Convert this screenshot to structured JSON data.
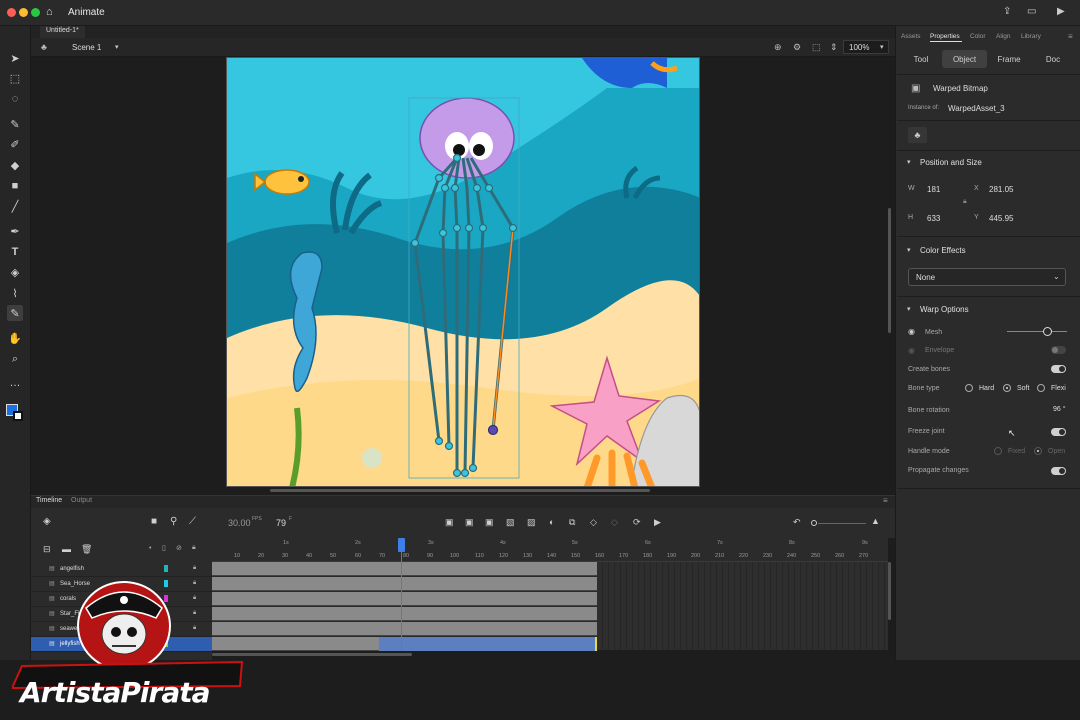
{
  "app": {
    "name": "Animate",
    "doc_tab": "Untitled-1*",
    "scene": "Scene 1",
    "zoom": "100%"
  },
  "panel": {
    "tabs": [
      "Assets",
      "Properties",
      "Color",
      "Align",
      "Library"
    ],
    "subtabs": [
      "Tool",
      "Object",
      "Frame",
      "Doc"
    ],
    "object_type": "Warped Bitmap",
    "instance_label": "Instance of:",
    "instance_value": "WarpedAsset_3",
    "pos_size": {
      "title": "Position and Size",
      "w_label": "W",
      "w": "181",
      "x_label": "X",
      "x": "281.05",
      "h_label": "H",
      "h": "633",
      "y_label": "Y",
      "y": "445.95"
    },
    "color_effects": {
      "title": "Color Effects",
      "value": "None"
    },
    "warp": {
      "title": "Warp Options",
      "mesh": "Mesh",
      "envelope": "Envelope",
      "create_bones": "Create bones",
      "bone_type": "Bone type",
      "bone_type_options": [
        "Hard",
        "Soft",
        "Flexi"
      ],
      "bone_rotation": "Bone rotation",
      "bone_rotation_value": "96 °",
      "freeze_joint": "Freeze joint",
      "handle_mode": "Handle mode",
      "handle_mode_options": [
        "Fixed",
        "Open"
      ],
      "propagate": "Propagate changes"
    }
  },
  "timeline": {
    "tabs": [
      "Timeline",
      "Output"
    ],
    "fps": "30.00",
    "fps_unit": "FPS",
    "frame": "79",
    "frame_unit": "F",
    "seconds": [
      "1s",
      "2s",
      "3s",
      "4s",
      "5s",
      "6s",
      "7s",
      "8s",
      "9s"
    ],
    "ticks": [
      "10",
      "20",
      "30",
      "40",
      "50",
      "60",
      "70",
      "80",
      "90",
      "100",
      "110",
      "120",
      "130",
      "140",
      "150",
      "160",
      "170",
      "180",
      "190",
      "200",
      "210",
      "220",
      "230",
      "240",
      "250",
      "260",
      "270"
    ],
    "layers": [
      "angelfish",
      "Sea_Horse",
      "corals",
      "Star_Fi",
      "seawe",
      "jellyfish"
    ],
    "layer_colors": [
      "#22b5b5",
      "#1fc9e8",
      "#e02fd8",
      "#f0e040",
      "#7a3cf0",
      "#8fd640"
    ]
  },
  "watermark": "ArtistaPirata"
}
